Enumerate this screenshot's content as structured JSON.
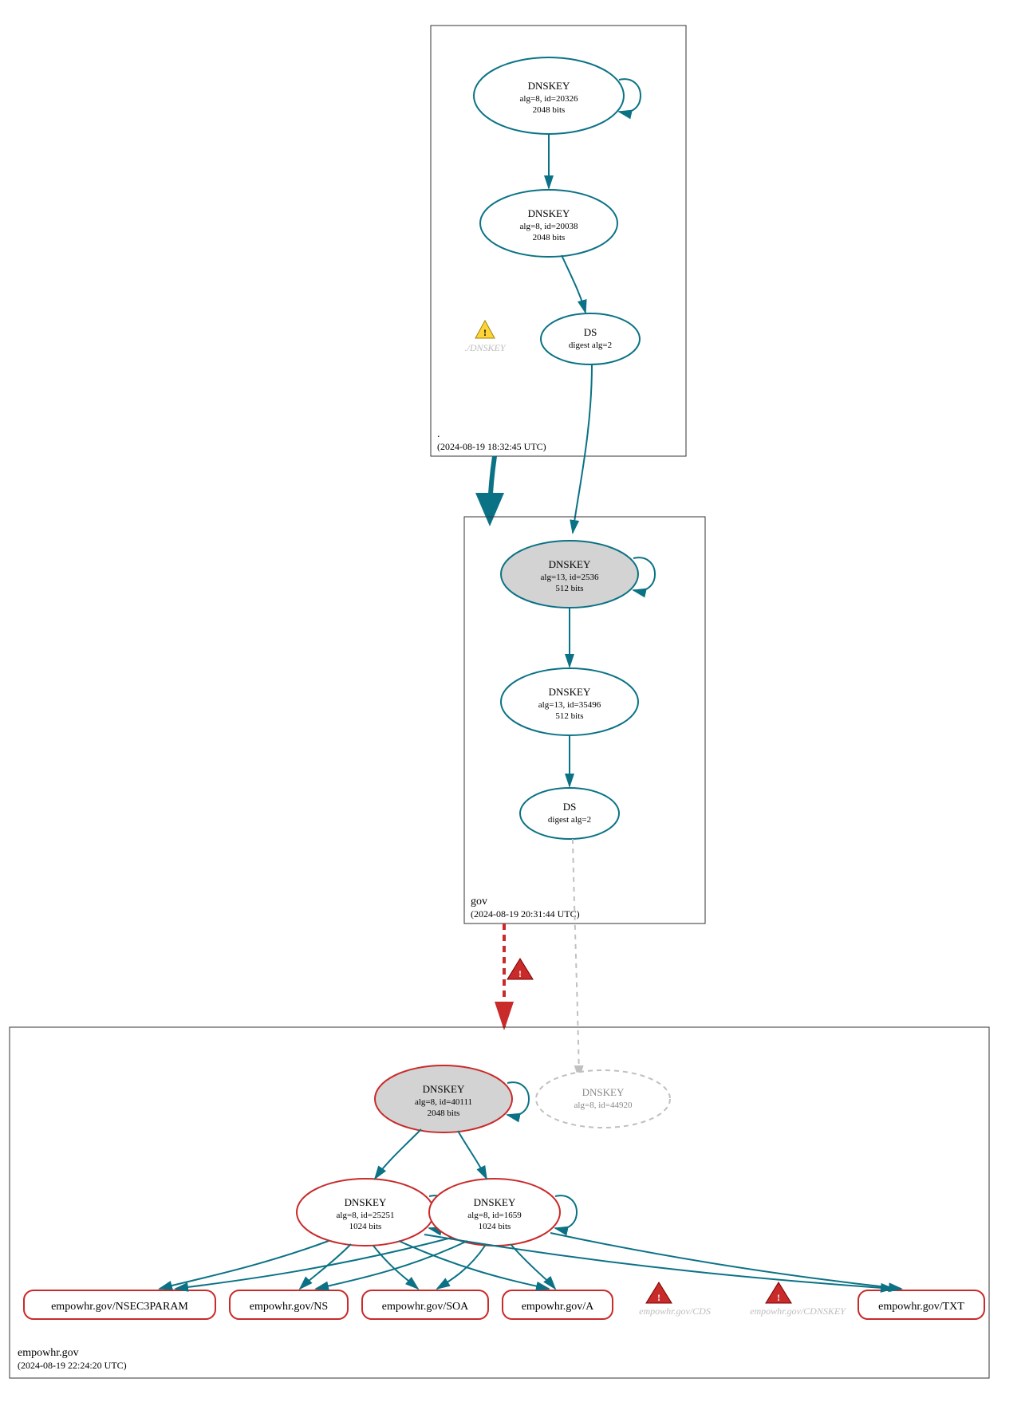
{
  "zones": {
    "root": {
      "label": ".",
      "timestamp": "(2024-08-19 18:32:45 UTC)"
    },
    "gov": {
      "label": "gov",
      "timestamp": "(2024-08-19 20:31:44 UTC)"
    },
    "empowhr": {
      "label": "empowhr.gov",
      "timestamp": "(2024-08-19 22:24:20 UTC)"
    }
  },
  "nodes": {
    "root_ksk": {
      "title": "DNSKEY",
      "line1": "alg=8, id=20326",
      "line2": "2048 bits"
    },
    "root_zsk": {
      "title": "DNSKEY",
      "line1": "alg=8, id=20038",
      "line2": "2048 bits"
    },
    "root_ds": {
      "title": "DS",
      "line1": "digest alg=2"
    },
    "root_missing_dnskey": "./DNSKEY",
    "gov_ksk": {
      "title": "DNSKEY",
      "line1": "alg=13, id=2536",
      "line2": "512 bits"
    },
    "gov_zsk": {
      "title": "DNSKEY",
      "line1": "alg=13, id=35496",
      "line2": "512 bits"
    },
    "gov_ds": {
      "title": "DS",
      "line1": "digest alg=2"
    },
    "emp_ksk": {
      "title": "DNSKEY",
      "line1": "alg=8, id=40111",
      "line2": "2048 bits"
    },
    "emp_ghost": {
      "title": "DNSKEY",
      "line1": "alg=8, id=44920"
    },
    "emp_zsk1": {
      "title": "DNSKEY",
      "line1": "alg=8, id=25251",
      "line2": "1024 bits"
    },
    "emp_zsk2": {
      "title": "DNSKEY",
      "line1": "alg=8, id=1659",
      "line2": "1024 bits"
    },
    "rr_nsec3param": "empowhr.gov/NSEC3PARAM",
    "rr_ns": "empowhr.gov/NS",
    "rr_soa": "empowhr.gov/SOA",
    "rr_a": "empowhr.gov/A",
    "rr_txt": "empowhr.gov/TXT",
    "missing_cds": "empowhr.gov/CDS",
    "missing_cdnskey": "empowhr.gov/CDNSKEY"
  },
  "diagram_data": {
    "type": "dnssec-authentication-graph",
    "zones": [
      {
        "name": ".",
        "analyzed_at": "2024-08-19 18:32:45 UTC",
        "keys": [
          {
            "rrtype": "DNSKEY",
            "alg": 8,
            "id": 20326,
            "bits": 2048,
            "role": "KSK",
            "trust_anchor": true
          },
          {
            "rrtype": "DNSKEY",
            "alg": 8,
            "id": 20038,
            "bits": 2048,
            "role": "ZSK"
          }
        ],
        "ds": [
          {
            "digest_alg": 2,
            "for_zone": "gov"
          }
        ],
        "warnings": [
          {
            "kind": "missing",
            "target": "./DNSKEY"
          }
        ]
      },
      {
        "name": "gov",
        "analyzed_at": "2024-08-19 20:31:44 UTC",
        "keys": [
          {
            "rrtype": "DNSKEY",
            "alg": 13,
            "id": 2536,
            "bits": 512,
            "role": "KSK"
          },
          {
            "rrtype": "DNSKEY",
            "alg": 13,
            "id": 35496,
            "bits": 512,
            "role": "ZSK"
          }
        ],
        "ds": [
          {
            "digest_alg": 2,
            "for_zone": "empowhr.gov"
          }
        ]
      },
      {
        "name": "empowhr.gov",
        "analyzed_at": "2024-08-19 22:24:20 UTC",
        "keys": [
          {
            "rrtype": "DNSKEY",
            "alg": 8,
            "id": 40111,
            "bits": 2048,
            "role": "KSK",
            "status": "bogus"
          },
          {
            "rrtype": "DNSKEY",
            "alg": 8,
            "id": 44920,
            "status": "referenced-only"
          },
          {
            "rrtype": "DNSKEY",
            "alg": 8,
            "id": 25251,
            "bits": 1024,
            "role": "ZSK",
            "status": "bogus"
          },
          {
            "rrtype": "DNSKEY",
            "alg": 8,
            "id": 1659,
            "bits": 1024,
            "role": "ZSK",
            "status": "bogus"
          }
        ],
        "rrsets": [
          {
            "name": "empowhr.gov/NSEC3PARAM",
            "status": "bogus"
          },
          {
            "name": "empowhr.gov/NS",
            "status": "bogus"
          },
          {
            "name": "empowhr.gov/SOA",
            "status": "bogus"
          },
          {
            "name": "empowhr.gov/A",
            "status": "bogus"
          },
          {
            "name": "empowhr.gov/TXT",
            "status": "bogus"
          }
        ],
        "errors": [
          {
            "kind": "missing",
            "target": "empowhr.gov/CDS"
          },
          {
            "kind": "missing",
            "target": "empowhr.gov/CDNSKEY"
          }
        ]
      }
    ],
    "delegations": [
      {
        "from": ".",
        "to": "gov",
        "status": "secure"
      },
      {
        "from": "gov",
        "to": "empowhr.gov",
        "status": "bogus"
      }
    ]
  }
}
